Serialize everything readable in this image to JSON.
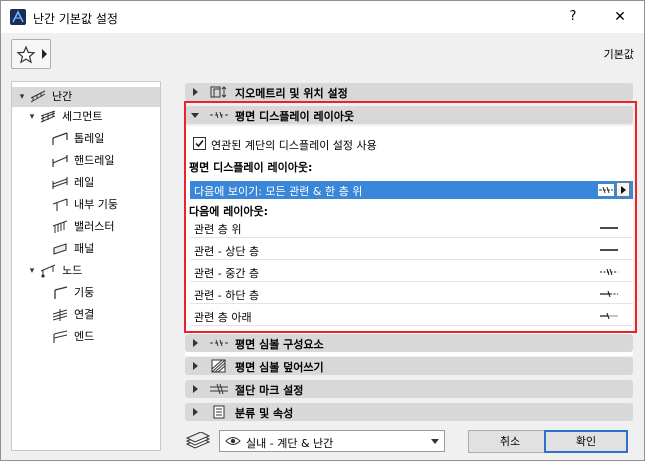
{
  "window": {
    "title": "난간 기본값 설정",
    "help": "?",
    "close": "✕",
    "default_label": "기본값"
  },
  "tree": {
    "items": [
      {
        "label": "난간",
        "icon": "railing-icon",
        "level": 0,
        "expanded": true,
        "selected": true
      },
      {
        "label": "세그먼트",
        "icon": "segment-icon",
        "level": 1,
        "expanded": true
      },
      {
        "label": "톱레일",
        "icon": "toprail-icon",
        "level": 2
      },
      {
        "label": "핸드레일",
        "icon": "handrail-icon",
        "level": 2
      },
      {
        "label": "레일",
        "icon": "rail-icon",
        "level": 2
      },
      {
        "label": "내부 기둥",
        "icon": "inner-post-icon",
        "level": 2
      },
      {
        "label": "밸러스터",
        "icon": "baluster-icon",
        "level": 2
      },
      {
        "label": "패널",
        "icon": "panel-icon",
        "level": 2
      },
      {
        "label": "노드",
        "icon": "node-icon",
        "level": 1,
        "expanded": true
      },
      {
        "label": "기둥",
        "icon": "post-icon",
        "level": 2
      },
      {
        "label": "연결",
        "icon": "connection-icon",
        "level": 2
      },
      {
        "label": "엔드",
        "icon": "end-icon",
        "level": 2
      }
    ]
  },
  "sections": {
    "geometry": "지오메트리 및 위치 설정",
    "floor_display": "평면 디스플레이 레이아웃",
    "symbol_components": "평면 심볼 구성요소",
    "symbol_override": "평면 심볼 덮어쓰기",
    "cut_marks": "절단 마크 설정",
    "classification": "분류 및 속성"
  },
  "floor_panel": {
    "checkbox_label": "연관된 계단의 디스플레이 설정 사용",
    "checked": true,
    "layout_heading": "평면 디스플레이 레이아웃:",
    "selected_row": "다음에 보이기: 모든 관련 & 한 층 위",
    "show_heading": "다음에 레이아웃:",
    "rows": [
      {
        "label": "관련 층 위"
      },
      {
        "label": "관련 - 상단 층"
      },
      {
        "label": "관련 - 중간 층"
      },
      {
        "label": "관련 - 하단 층"
      },
      {
        "label": "관련 층 아래"
      }
    ]
  },
  "bottom": {
    "layer_combo": "실내 - 계단 & 난간",
    "cancel": "취소",
    "ok": "확인"
  },
  "colors": {
    "selection": "#3a86d8",
    "highlight_frame": "#e8232b",
    "ok_border": "#2d72c8"
  }
}
